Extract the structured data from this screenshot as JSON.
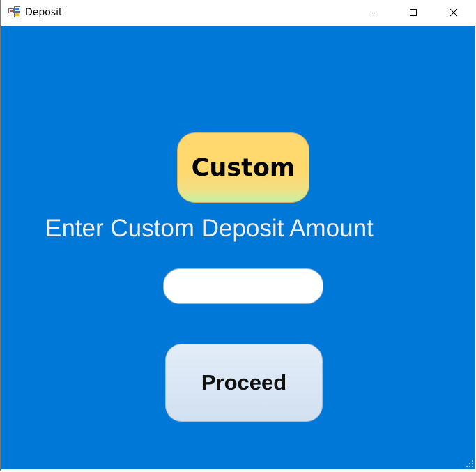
{
  "window": {
    "title": "Deposit"
  },
  "titlebar_buttons": {
    "minimize": "minimize-icon",
    "maximize": "maximize-icon",
    "close": "close-icon"
  },
  "form": {
    "custom_button_label": "Custom",
    "prompt_label": "Enter Custom Deposit Amount",
    "amount_value": "",
    "proceed_button_label": "Proceed"
  },
  "colors": {
    "client_background": "#0078d7",
    "custom_button": "#ffd96f",
    "proceed_button": "#dce8f6"
  }
}
